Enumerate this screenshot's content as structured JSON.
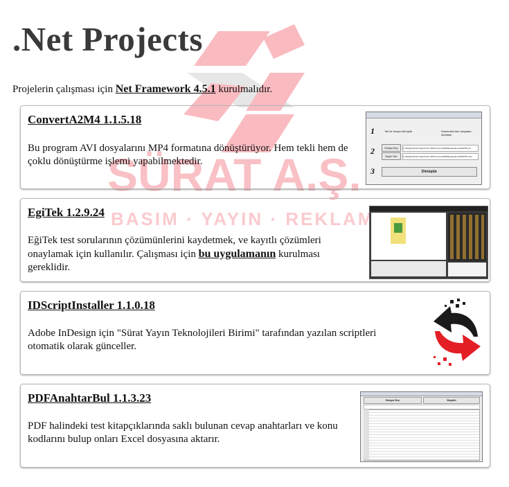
{
  "page": {
    "title": ".Net Projects",
    "intro_before": "Projelerin çalışması için ",
    "intro_link": "Net Framework 4.5.1",
    "intro_after": " kurulmalıdır."
  },
  "watermark": {
    "name": "SÜRAT A.Ş.",
    "subtitle": "BASIM · YAYIN · REKLAM"
  },
  "projects": [
    {
      "title": "ConvertA2M4 1.1.5.18",
      "description": "Bu program AVI dosyalarını MP4 formatına dönüştürüyor. Hem tekli hem de çoklu dönüştürme işlemi yapabilmektedir.",
      "screenshot": {
        "opt1": "Tek bir dosya dönüştür",
        "opt2": "Klasördeki tüm dosyaları dönüştür",
        "btn_select": "Dosya Seç",
        "btn_save": "Kayıt Yeri",
        "path1": "C:\\Deskiyor\\File Projects\\VS .NET\\ConvertA2M4\\Examples AVI\\a0755.avi",
        "path2": "C:\\Deskiyor\\File Projects\\VS .NET\\ConvertA2M4\\Examples AVI\\a0755.mp4",
        "btn_convert": "Dönüştür"
      }
    },
    {
      "title": "EgiTek 1.2.9.24",
      "description_before": "EğiTek test sorularının çözümünlerini kaydetmek, ve kayıtlı çözümleri onaylamak için kullanılır. Çalışması için ",
      "description_link": "bu uygulamanın",
      "description_after": " kurulması gereklidir."
    },
    {
      "title": "IDScriptInstaller 1.1.0.18",
      "description": "Adobe InDesign için \"Sürat Yayın Teknolojileri Birimi\" tarafından yazılan scriptleri otomatik olarak günceller."
    },
    {
      "title": "PDFAnahtarBul 1.1.3.23",
      "description": "PDF halindeki test kitapçıklarında saklı bulunan cevap anahtarları ve konu kodlarını bulup onları Excel dosyasına aktarır.",
      "screenshot": {
        "btn1": "Dosya Seç",
        "btn2": "Kaydet"
      }
    }
  ],
  "colors": {
    "watermark_red": "#f26b76",
    "watermark_gray": "#c8c8c8",
    "sync_red": "#e41e25",
    "sync_black": "#1a1a1a"
  }
}
